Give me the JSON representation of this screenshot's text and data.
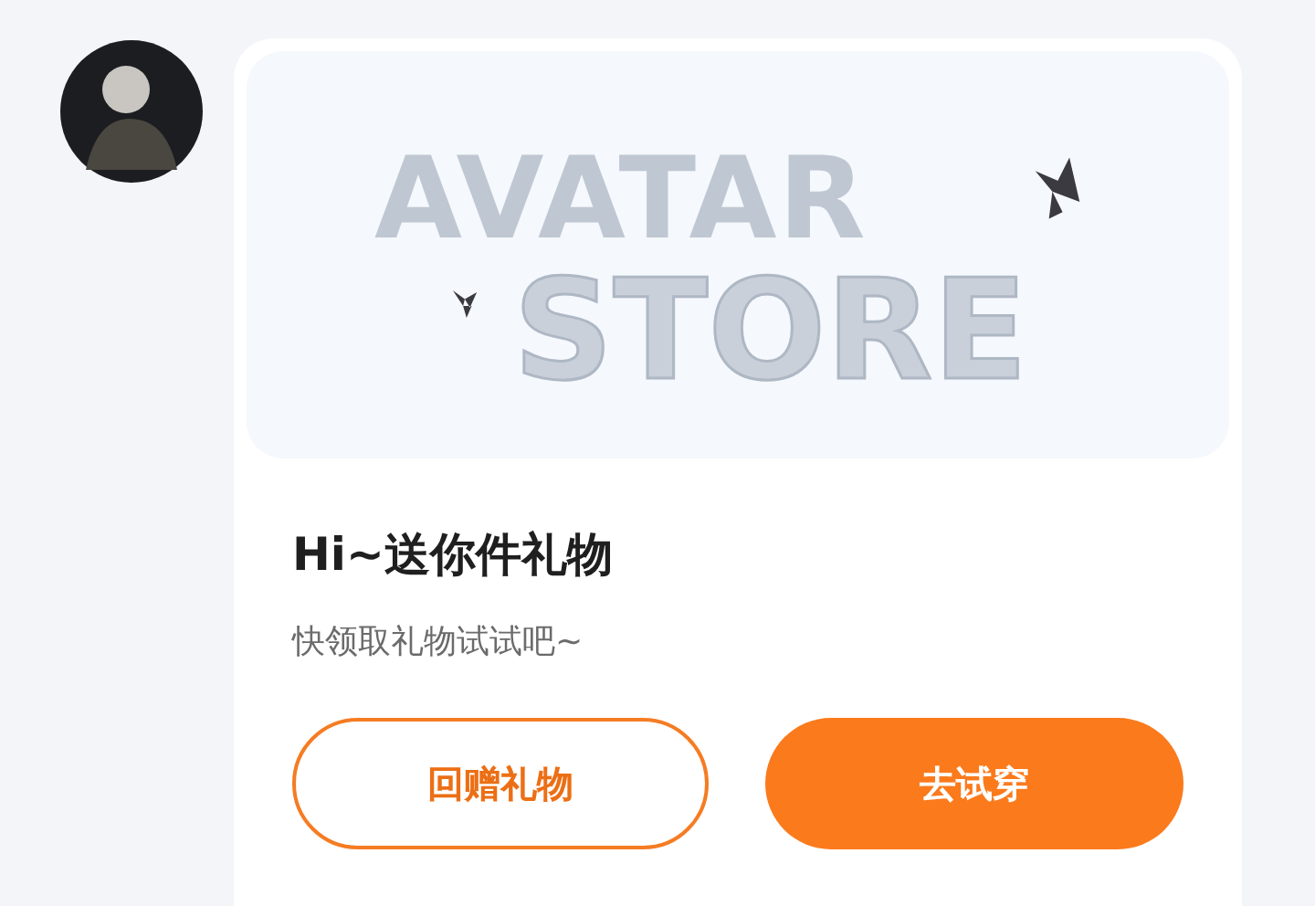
{
  "banner": {
    "headline": "AVATAR",
    "subline": "STORE"
  },
  "title": "Hi~送你件礼物",
  "subtitle": "快领取礼物试试吧~",
  "buttons": [
    {
      "label": "回赠礼物",
      "kind": "outline"
    },
    {
      "label": "去试穿",
      "kind": "filled"
    }
  ]
}
